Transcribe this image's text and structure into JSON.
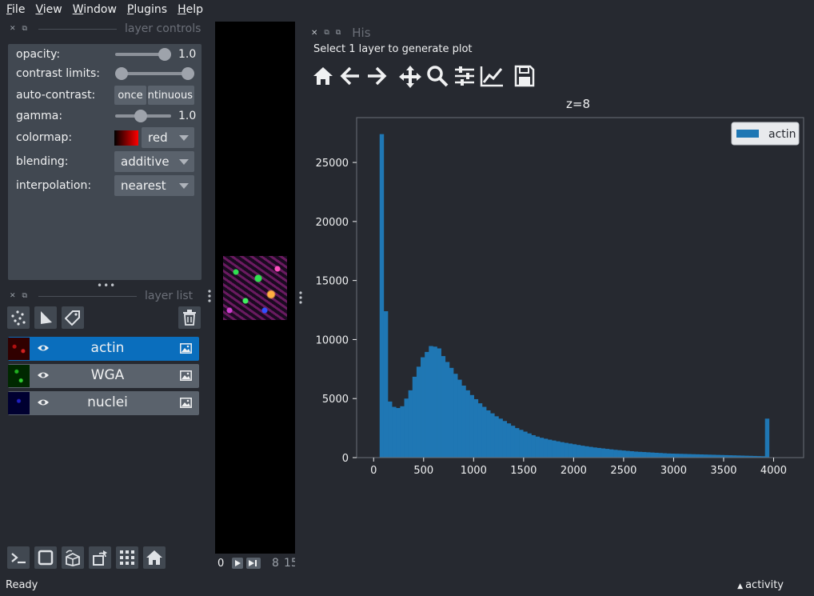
{
  "menu": {
    "items": [
      {
        "label": "File",
        "mnemonic": "F",
        "rest": "ile"
      },
      {
        "label": "View",
        "mnemonic": "V",
        "rest": "iew"
      },
      {
        "label": "Window",
        "mnemonic": "W",
        "rest": "indow"
      },
      {
        "label": "Plugins",
        "mnemonic": "P",
        "rest": "lugins"
      },
      {
        "label": "Help",
        "mnemonic": "H",
        "rest": "elp"
      }
    ]
  },
  "layer_controls": {
    "title": "layer controls",
    "opacity_label": "opacity:",
    "opacity_value": "1.0",
    "opacity_level": 1.0,
    "contrast_label": "contrast limits:",
    "auto_contrast_label": "auto-contrast:",
    "once_label": "once",
    "continuous_label": "continuous",
    "gamma_label": "gamma:",
    "gamma_value": "1.0",
    "colormap_label": "colormap:",
    "colormap_value": "red",
    "blending_label": "blending:",
    "blending_value": "additive",
    "interpolation_label": "interpolation:",
    "interpolation_value": "nearest"
  },
  "layer_list": {
    "title": "layer list",
    "layers": [
      {
        "name": "actin",
        "color": "#e02020",
        "selected": true
      },
      {
        "name": "WGA",
        "color": "#20c020",
        "selected": false
      },
      {
        "name": "nuclei",
        "color": "#3030e0",
        "selected": false
      }
    ]
  },
  "canvas": {
    "dims_start": "0",
    "dims_value": "8",
    "dims_max": "15"
  },
  "histogram": {
    "tab_title": "His",
    "instruction": "Select 1 layer to generate plot",
    "plot_title": "z=8"
  },
  "status": {
    "text": "Ready",
    "activity": "activity"
  },
  "colors": {
    "bg": "#262930",
    "panel": "#414851",
    "button": "#5a626c",
    "selected": "#0a6ebd",
    "bar": "#1f77b4"
  },
  "chart_data": {
    "type": "bar",
    "title": "z=8",
    "legend": [
      "actin"
    ],
    "legend_position": "top-right",
    "xlim": [
      -170,
      4300
    ],
    "ylim": [
      0,
      28800
    ],
    "xticks": [
      0,
      500,
      1000,
      1500,
      2000,
      2500,
      3000,
      3500,
      4000
    ],
    "yticks": [
      0,
      5000,
      10000,
      15000,
      20000,
      25000
    ],
    "bin_width": 41,
    "bin_start": 60,
    "series": [
      {
        "name": "actin",
        "values": [
          27400,
          12400,
          4750,
          4300,
          4200,
          4350,
          5000,
          5700,
          6850,
          7700,
          8500,
          8950,
          9450,
          9400,
          9250,
          8600,
          8100,
          7600,
          7100,
          6600,
          6100,
          5700,
          5300,
          4950,
          4600,
          4300,
          4000,
          3750,
          3500,
          3300,
          3100,
          2900,
          2700,
          2500,
          2350,
          2200,
          2050,
          1900,
          1780,
          1680,
          1600,
          1520,
          1450,
          1380,
          1310,
          1250,
          1190,
          1130,
          1070,
          1010,
          960,
          910,
          860,
          820,
          780,
          740,
          700,
          660,
          630,
          600,
          570,
          540,
          510,
          490,
          470,
          450,
          430,
          410,
          390,
          370,
          350,
          340,
          330,
          320,
          310,
          300,
          290,
          280,
          270,
          260,
          250,
          240,
          230,
          220,
          210,
          200,
          190,
          180,
          170,
          160,
          150,
          140,
          130,
          120,
          3300
        ]
      }
    ]
  }
}
